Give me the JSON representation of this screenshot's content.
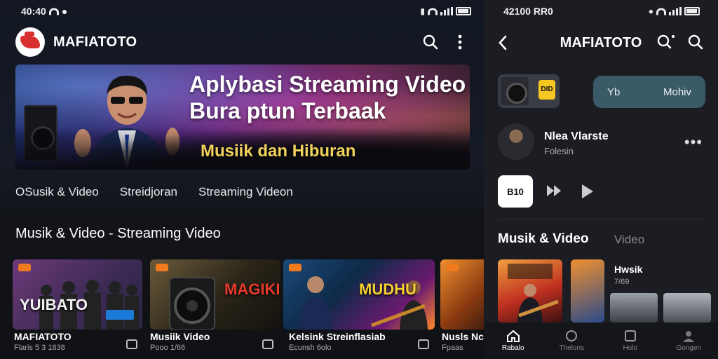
{
  "left": {
    "status": {
      "time": "40:40"
    },
    "app": {
      "title": "MAFIATOTO"
    },
    "hero": {
      "line1": "Aplybasi Streaming Video",
      "line2": "Bura ptun Terbaak",
      "line3": "Musiik dan Hiburan"
    },
    "tabs": [
      "OSusik & Video",
      "Streidjoran",
      "Streaming Videon"
    ],
    "section_title": "Musik & Video - Streaming Video",
    "cards": [
      {
        "overlay": "YUIBATO",
        "title": "MAFIATOTO",
        "sub": "Flaris 5 3 1838"
      },
      {
        "overlay": "MAGIKI",
        "title": "Musiik Video",
        "sub": "Pooo 1/66"
      },
      {
        "overlay": "MUDHU",
        "title": "Kelsink Streinflasiab",
        "sub": "Ecunsh 6olo"
      },
      {
        "overlay": "",
        "title": "Nusls Nc",
        "sub": "Fpaas"
      }
    ]
  },
  "right": {
    "status": {
      "time": "42100 RR0"
    },
    "app": {
      "title": "MAFIATOTO"
    },
    "pill": {
      "left": "Yb",
      "right": "Mohiv"
    },
    "thumb_badge": "DID",
    "artist": {
      "name": "Nlea Vlarste",
      "sub": "Folesin"
    },
    "play_label": "B10",
    "section": {
      "title": "Musik & Video",
      "secondary": "Video"
    },
    "list_item": {
      "title": "Hwsik",
      "sub": "7/69"
    },
    "nav": [
      {
        "label": "Rabalo",
        "icon": "home-icon"
      },
      {
        "label": "Thelons",
        "icon": "explore-icon"
      },
      {
        "label": "Holo",
        "icon": "library-icon"
      },
      {
        "label": "Gongen",
        "icon": "profile-icon"
      }
    ]
  }
}
